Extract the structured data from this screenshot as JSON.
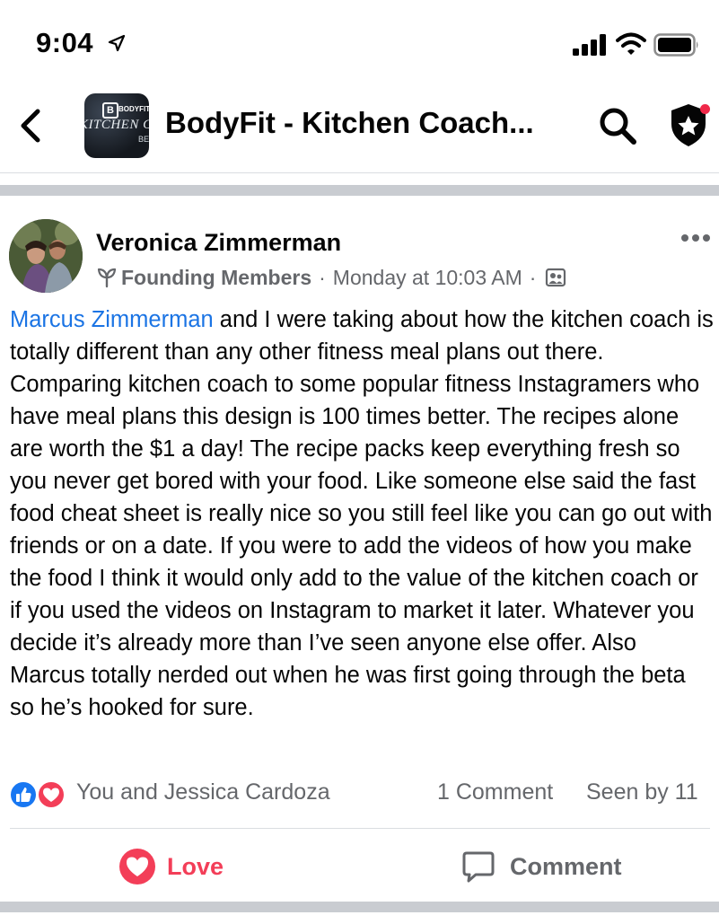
{
  "status_bar": {
    "time": "9:04"
  },
  "header": {
    "group_name": "BodyFit - Kitchen Coach...",
    "thumbnail": {
      "logo_b": "B",
      "logo_small": "BODYFIT",
      "logo_main": "KITCHEN COACH",
      "logo_be": "BE"
    }
  },
  "post": {
    "author": "Veronica Zimmerman",
    "badge": "Founding Members",
    "timestamp": "Monday at 10:03 AM",
    "separator": "·",
    "mention": "Marcus Zimmerman",
    "body": " and I were taking about how the kitchen coach is totally different than any other fitness meal plans out there. Comparing kitchen coach to some popular fitness Instagramers who have meal plans this design is 100 times better. The recipes alone are worth the $1 a day!  The recipe packs keep everything fresh so you never get bored with your food. Like someone else said the fast food cheat sheet is really nice so you still feel like you can go out with friends or on a date. If you were to add the videos of how you make the food I think it would only add to the value of the kitchen coach or if you used the videos on Instagram to market it later. Whatever you decide it’s already more than I’ve seen anyone else offer. Also Marcus totally nerded out when he was first going through the beta so he’s hooked for sure.",
    "reactions_names": "You and Jessica Cardoza",
    "comments_count": "1 Comment",
    "seen_by": "Seen by 11"
  },
  "actions": {
    "love_label": "Love",
    "comment_label": "Comment"
  },
  "icons": {
    "location": "location-arrow-icon",
    "signal": "cellular-signal-icon",
    "wifi": "wifi-icon",
    "battery": "battery-icon",
    "back": "back-chevron-icon",
    "search": "search-icon",
    "admin_badge": "shield-star-icon",
    "more": "more-dots-icon",
    "founding": "sprout-icon",
    "audience": "members-audience-icon",
    "like_reaction": "like-reaction-icon",
    "love_reaction": "love-reaction-icon",
    "love_button": "love-icon",
    "comment_button": "comment-icon"
  },
  "colors": {
    "mention": "#1b74e4",
    "love": "#f33e58",
    "like": "#1877f2",
    "secondary_text": "#65676b",
    "separator": "#c9ccd1"
  }
}
